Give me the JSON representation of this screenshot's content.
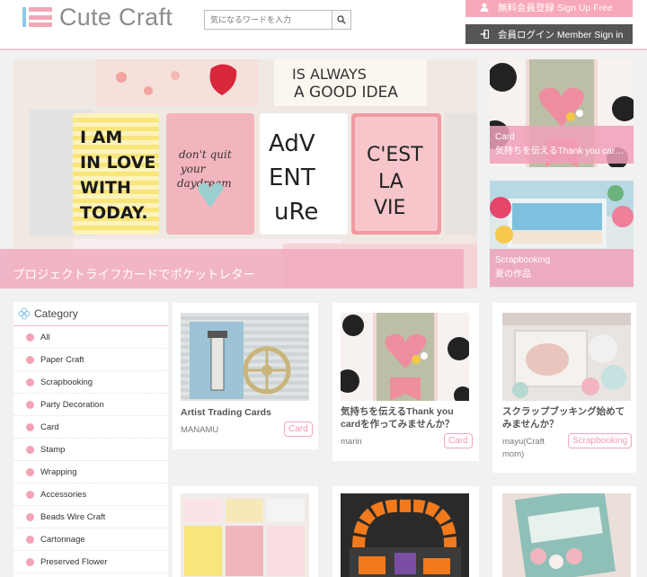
{
  "header": {
    "logo_text": "Cute Craft",
    "search_placeholder": "気になるワードを入力",
    "signup_label": "無料会員登録 Sign Up Free",
    "signin_label": "会員ログイン Member Sign in"
  },
  "hero": {
    "caption": "プロジェクトライフカードでポケットレター"
  },
  "side_cards": [
    {
      "category": "Card",
      "title": "気持ちを伝えるThank you cardを作ってみませんか？"
    },
    {
      "category": "Scrapbooking",
      "title": "夏の作品"
    }
  ],
  "sidebar": {
    "heading": "Category",
    "items": [
      "All",
      "Paper Craft",
      "Scrapbooking",
      "Party Decoration",
      "Card",
      "Stamp",
      "Wrapping",
      "Accessories",
      "Beads Wire Craft",
      "Cartonnage",
      "Preserved Flower"
    ]
  },
  "posts": [
    {
      "title": "Artist Trading Cards",
      "author": "MANAMU",
      "tag": "Card"
    },
    {
      "title": "気持ちを伝えるThank you cardを作ってみませんか？",
      "author": "marin",
      "tag": "Card"
    },
    {
      "title": "スクラップブッキング始めてみませんか？",
      "author": "mayu(Craft mom)",
      "tag": "Scrapbooking"
    }
  ],
  "colors": {
    "accent_pink": "#f7a9ba",
    "dark_button": "#555555",
    "logo_blue": "#8ec9e8"
  }
}
